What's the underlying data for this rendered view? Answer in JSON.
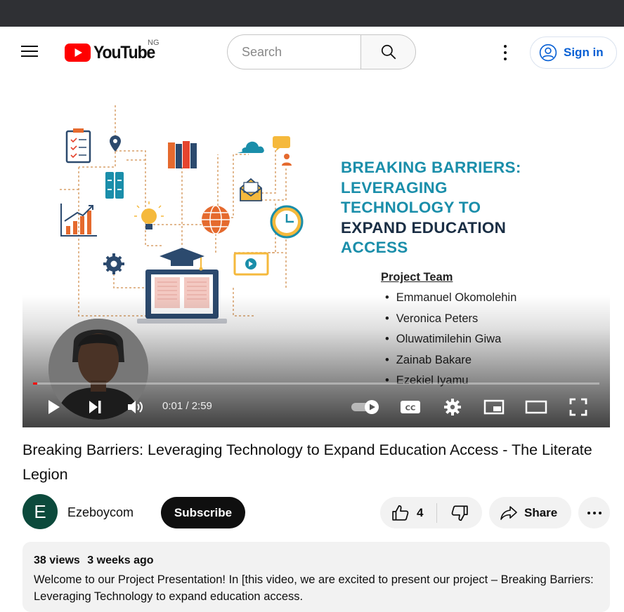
{
  "header": {
    "logo_text": "YouTube",
    "region_code": "NG",
    "search_placeholder": "Search",
    "sign_in_label": "Sign in"
  },
  "slide": {
    "title_lines": [
      "BREAKING BARRIERS:",
      "LEVERAGING",
      "TECHNOLOGY TO",
      "EXPAND EDUCATION",
      "ACCESS"
    ],
    "team_heading": "Project Team",
    "team_members": [
      "Emmanuel Okomolehin",
      "Veronica Peters",
      "Oluwatimilehin Giwa",
      "Zainab Bakare",
      "Ezekiel Iyamu"
    ]
  },
  "player": {
    "current_time": "0:01",
    "duration": "2:59",
    "time_display": "0:01 / 2:59",
    "progress_fraction": 0.006
  },
  "video": {
    "title": "Breaking Barriers: Leveraging Technology to Expand Education Access - The Literate Legion"
  },
  "owner": {
    "avatar_letter": "E",
    "channel_name": "Ezeboycom",
    "subscribe_label": "Subscribe",
    "like_count": "4",
    "share_label": "Share"
  },
  "description": {
    "views": "38 views",
    "age": "3 weeks ago",
    "text": "Welcome to our Project Presentation! In [this video, we are excited to present our project – Breaking Barriers: Leveraging Technology to expand education access."
  },
  "colors": {
    "brand_red": "#ff0000",
    "slide_title_teal": "#1a8eaa",
    "slide_title_dark": "#1a2e44",
    "link_blue": "#065fd4",
    "avatar_bg": "#0c4a3c"
  }
}
